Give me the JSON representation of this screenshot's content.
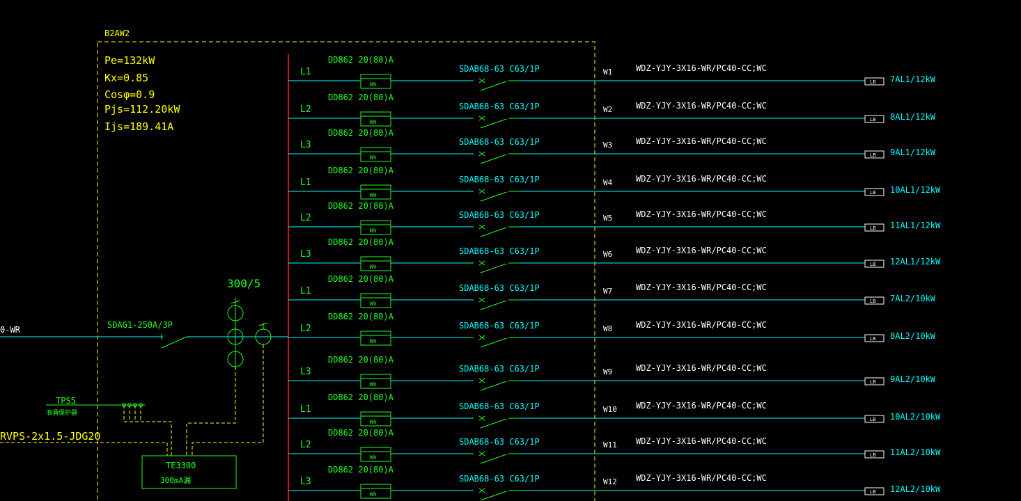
{
  "panel": {
    "name": "B2AW2",
    "params": [
      "Pe=132kW",
      "Kx=0.85",
      "Cosφ=0.9",
      "Pjs=112.20kW",
      "Ijs=189.41A"
    ]
  },
  "incoming": {
    "cable_fragment": "0-WR",
    "breaker": "SDAG1-250A/3P",
    "ct_ratio": "300/5",
    "spd": "TPS5",
    "spd_note": "浪涌保护器",
    "control_cable": "RVPS-2x1.5-JDG20",
    "monitor": "TE3300",
    "monitor_note": "300mA漏"
  },
  "meter_glyph": "Wh",
  "lb_label": "LB",
  "circuits": [
    {
      "phase": "L1",
      "meter": "DD862 20(80)A",
      "breaker": "SDAB68-63 C63/1P",
      "id": "W1",
      "cable": "WDZ-YJY-3X16-WR/PC40-CC;WC",
      "load": "7AL1/12kW"
    },
    {
      "phase": "L2",
      "meter": "DD862 20(80)A",
      "breaker": "SDAB68-63 C63/1P",
      "id": "W2",
      "cable": "WDZ-YJY-3X16-WR/PC40-CC;WC",
      "load": "8AL1/12kW"
    },
    {
      "phase": "L3",
      "meter": "DD862 20(80)A",
      "breaker": "SDAB68-63 C63/1P",
      "id": "W3",
      "cable": "WDZ-YJY-3X16-WR/PC40-CC;WC",
      "load": "9AL1/12kW"
    },
    {
      "phase": "L1",
      "meter": "DD862 20(80)A",
      "breaker": "SDAB68-63 C63/1P",
      "id": "W4",
      "cable": "WDZ-YJY-3X16-WR/PC40-CC;WC",
      "load": "10AL1/12kW"
    },
    {
      "phase": "L2",
      "meter": "DD862 20(80)A",
      "breaker": "SDAB68-63 C63/1P",
      "id": "W5",
      "cable": "WDZ-YJY-3X16-WR/PC40-CC;WC",
      "load": "11AL1/12kW"
    },
    {
      "phase": "L3",
      "meter": "DD862 20(80)A",
      "breaker": "SDAB68-63 C63/1P",
      "id": "W6",
      "cable": "WDZ-YJY-3X16-WR/PC40-CC;WC",
      "load": "12AL1/12kW"
    },
    {
      "phase": "L1",
      "meter": "DD862 20(80)A",
      "breaker": "SDAB68-63 C63/1P",
      "id": "W7",
      "cable": "WDZ-YJY-3X16-WR/PC40-CC;WC",
      "load": "7AL2/10kW"
    },
    {
      "phase": "L2",
      "meter": "DD862 20(80)A",
      "breaker": "SDAB68-63 C63/1P",
      "id": "W8",
      "cable": "WDZ-YJY-3X16-WR/PC40-CC;WC",
      "load": "8AL2/10kW"
    },
    {
      "phase": "L3",
      "meter": "DD862 20(80)A",
      "breaker": "SDAB68-63 C63/1P",
      "id": "W9",
      "cable": "WDZ-YJY-3X16-WR/PC40-CC;WC",
      "load": "9AL2/10kW"
    },
    {
      "phase": "L1",
      "meter": "DD862 20(80)A",
      "breaker": "SDAB68-63 C63/1P",
      "id": "W10",
      "cable": "WDZ-YJY-3X16-WR/PC40-CC;WC",
      "load": "10AL2/10kW"
    },
    {
      "phase": "L2",
      "meter": "DD862 20(80)A",
      "breaker": "SDAB68-63 C63/1P",
      "id": "W11",
      "cable": "WDZ-YJY-3X16-WR/PC40-CC;WC",
      "load": "11AL2/10kW"
    },
    {
      "phase": "L3",
      "meter": "DD862 20(80)A",
      "breaker": "SDAB68-63 C63/1P",
      "id": "W12",
      "cable": "WDZ-YJY-3X16-WR/PC40-CC;WC",
      "load": "12AL2/10kW"
    }
  ],
  "colors": {
    "background": "#000000",
    "enclosure": "#ffff00",
    "feeder": "#00ffff",
    "component": "#22ff22",
    "busbar": "#ff2222",
    "text_white": "#ffffff"
  }
}
